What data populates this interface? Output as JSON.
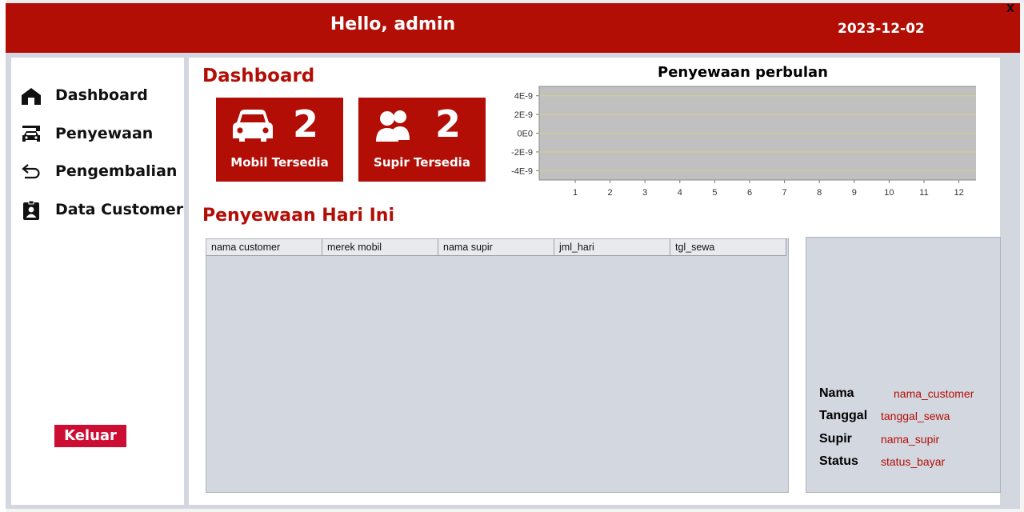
{
  "window": {
    "close_label": "X"
  },
  "header": {
    "greeting": "Hello, admin",
    "date": "2023-12-02"
  },
  "sidebar": {
    "items": [
      {
        "label": "Dashboard",
        "icon": "home-icon"
      },
      {
        "label": "Penyewaan",
        "icon": "car-garage-icon"
      },
      {
        "label": "Pengembalian",
        "icon": "return-arrow-icon"
      },
      {
        "label": "Data Customer",
        "icon": "id-badge-icon"
      }
    ],
    "logout_label": "Keluar"
  },
  "dashboard": {
    "title": "Dashboard",
    "cards": [
      {
        "count": "2",
        "label": "Mobil Tersedia",
        "icon": "car-icon"
      },
      {
        "count": "2",
        "label": "Supir Tersedia",
        "icon": "users-icon"
      }
    ]
  },
  "chart_data": {
    "type": "line",
    "title": "Penyewaan perbulan",
    "xlabel": "",
    "ylabel": "",
    "x": [
      "1",
      "2",
      "3",
      "4",
      "5",
      "6",
      "7",
      "8",
      "9",
      "10",
      "11",
      "12"
    ],
    "y_ticks": [
      "4E-9",
      "2E-9",
      "0E0",
      "-2E-9",
      "-4E-9"
    ],
    "ylim": [
      -5e-09,
      5e-09
    ],
    "series": [],
    "grid": true,
    "colors": {
      "plot_background": "#c0c0c0",
      "grid": "#d6d08a"
    }
  },
  "today": {
    "title": "Penyewaan Hari Ini",
    "columns": [
      "nama customer",
      "merek mobil",
      "nama supir",
      "jml_hari",
      "tgl_sewa"
    ],
    "rows": []
  },
  "detail": {
    "fields": [
      {
        "label": "Nama",
        "value": "nama_customer"
      },
      {
        "label": "Tanggal",
        "value": "tanggal_sewa"
      },
      {
        "label": "Supir",
        "value": "nama_supir"
      },
      {
        "label": "Status",
        "value": "status_bayar"
      }
    ]
  },
  "colors": {
    "brand": "#b20e06",
    "logout": "#cc0e35",
    "panel": "#d3d7df"
  }
}
